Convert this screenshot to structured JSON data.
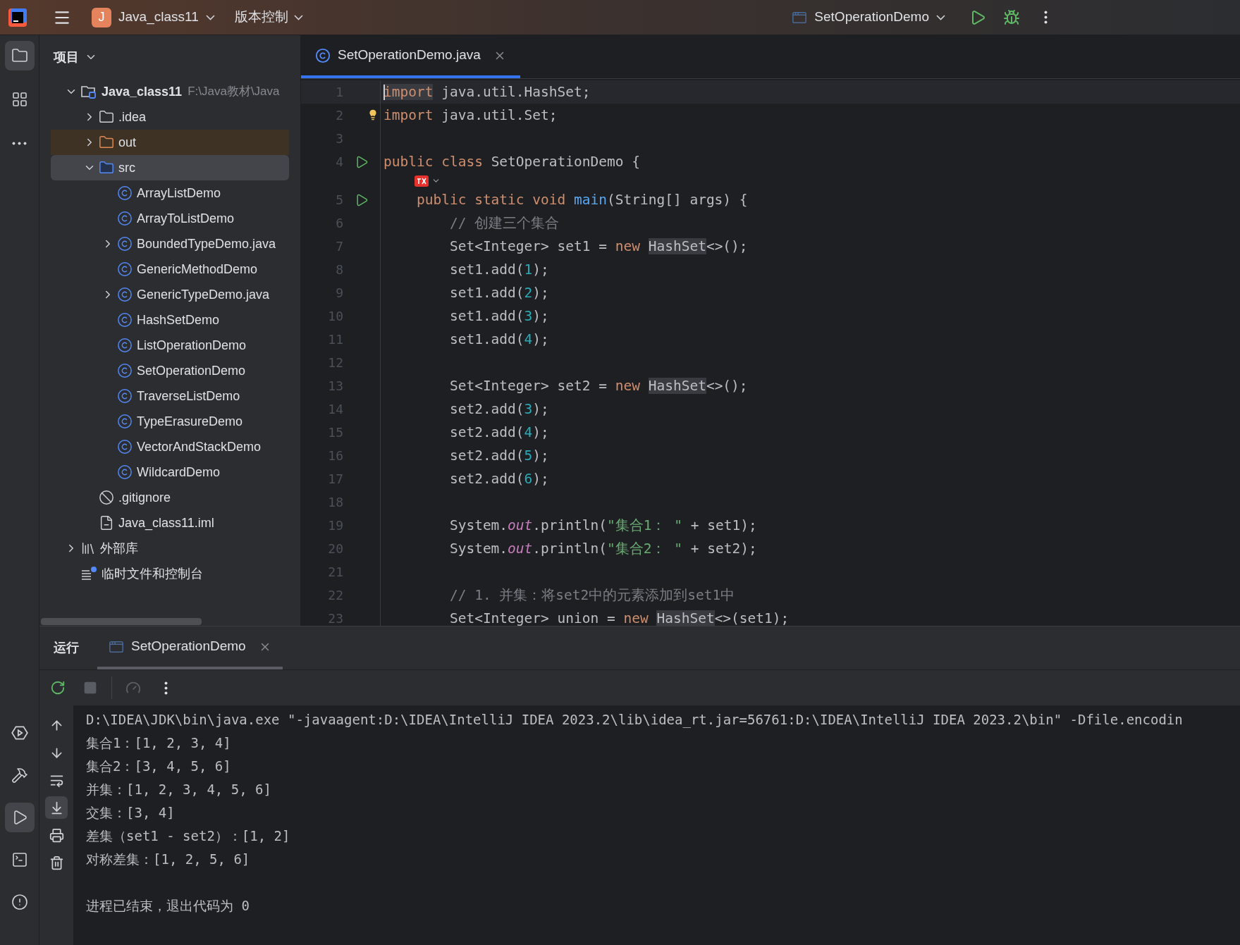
{
  "title_bar": {
    "project": {
      "initial": "J",
      "name": "Java_class11"
    },
    "vcs_menu": "版本控制",
    "run_config": "SetOperationDemo"
  },
  "left_toolbar": {
    "top": [
      {
        "kind": "project",
        "selected": true
      },
      {
        "kind": "structure",
        "selected": false
      },
      {
        "kind": "more",
        "selected": false
      }
    ],
    "bottom": [
      {
        "kind": "services",
        "selected": false
      },
      {
        "kind": "build",
        "selected": false
      },
      {
        "kind": "run",
        "selected": true
      },
      {
        "kind": "terminal",
        "selected": false
      },
      {
        "kind": "problems",
        "selected": false
      }
    ]
  },
  "project_panel": {
    "title": "项目",
    "tree": [
      {
        "kind": "module",
        "name": "Java_class11",
        "path": "F:\\Java教材\\Java",
        "expanded": true,
        "selected": false,
        "children": [
          {
            "kind": "folder",
            "name": ".idea",
            "expanded": false,
            "selected": false
          },
          {
            "kind": "excluded_folder",
            "name": "out",
            "expanded": false,
            "selected": false
          },
          {
            "kind": "source_folder",
            "name": "src",
            "expanded": true,
            "selected": true,
            "children": [
              {
                "kind": "class",
                "name": "ArrayListDemo",
                "selected": false
              },
              {
                "kind": "class",
                "name": "ArrayToListDemo",
                "selected": false
              },
              {
                "kind": "class",
                "name": "BoundedTypeDemo.java",
                "expanded": false,
                "selected": false
              },
              {
                "kind": "class",
                "name": "GenericMethodDemo",
                "selected": false
              },
              {
                "kind": "class",
                "name": "GenericTypeDemo.java",
                "expanded": false,
                "selected": false
              },
              {
                "kind": "class",
                "name": "HashSetDemo",
                "selected": false
              },
              {
                "kind": "class",
                "name": "ListOperationDemo",
                "selected": false
              },
              {
                "kind": "class",
                "name": "SetOperationDemo",
                "selected": false
              },
              {
                "kind": "class",
                "name": "TraverseListDemo",
                "selected": false
              },
              {
                "kind": "class",
                "name": "TypeErasureDemo",
                "selected": false
              },
              {
                "kind": "class",
                "name": "VectorAndStackDemo",
                "selected": false
              },
              {
                "kind": "class",
                "name": "WildcardDemo",
                "selected": false
              }
            ]
          },
          {
            "kind": "ignore_file",
            "name": ".gitignore",
            "selected": false
          },
          {
            "kind": "module_file",
            "name": "Java_class11.iml",
            "selected": false
          }
        ]
      },
      {
        "kind": "library",
        "name": "外部库",
        "expanded": false,
        "selected": false
      },
      {
        "kind": "scratches",
        "name": "临时文件和控制台",
        "selected": false
      }
    ]
  },
  "editor": {
    "tabs": [
      {
        "label": "SetOperationDemo.java",
        "selected": true
      }
    ],
    "lines": [
      {
        "kind": "code",
        "number": "1",
        "current": true,
        "tokens": [
          {
            "kind": "keyword_marked",
            "text": "import"
          },
          {
            "kind": "plain",
            "text": " java.util.HashSet;"
          }
        ]
      },
      {
        "kind": "code",
        "number": "2",
        "hint": true,
        "tokens": [
          {
            "kind": "keyword",
            "text": "import"
          },
          {
            "kind": "plain",
            "text": " java.util.Set;"
          }
        ]
      },
      {
        "kind": "code",
        "number": "3"
      },
      {
        "kind": "code",
        "number": "4",
        "runnable": true,
        "tokens": [
          {
            "kind": "keyword",
            "text": "public class "
          },
          {
            "kind": "plain",
            "text": "SetOperationDemo {"
          }
        ]
      },
      {
        "kind": "inlay"
      },
      {
        "kind": "code",
        "number": "5",
        "runnable": true,
        "tokens": [
          {
            "kind": "keyword",
            "text": "    public static void "
          },
          {
            "kind": "method",
            "text": "main"
          },
          {
            "kind": "plain",
            "text": "(String[] args) {"
          }
        ]
      },
      {
        "kind": "code",
        "number": "6",
        "tokens": [
          {
            "kind": "comment",
            "text": "        // 创建三个集合"
          }
        ]
      },
      {
        "kind": "code",
        "number": "7",
        "tokens": [
          {
            "kind": "plain",
            "text": "        Set<Integer> set1 = "
          },
          {
            "kind": "keyword",
            "text": "new "
          },
          {
            "kind": "type_marked",
            "text": "HashSet"
          },
          {
            "kind": "plain",
            "text": "<>();"
          }
        ]
      },
      {
        "kind": "code",
        "number": "8",
        "tokens": [
          {
            "kind": "plain",
            "text": "        set1.add("
          },
          {
            "kind": "number",
            "text": "1"
          },
          {
            "kind": "plain",
            "text": ");"
          }
        ]
      },
      {
        "kind": "code",
        "number": "9",
        "tokens": [
          {
            "kind": "plain",
            "text": "        set1.add("
          },
          {
            "kind": "number",
            "text": "2"
          },
          {
            "kind": "plain",
            "text": ");"
          }
        ]
      },
      {
        "kind": "code",
        "number": "10",
        "tokens": [
          {
            "kind": "plain",
            "text": "        set1.add("
          },
          {
            "kind": "number",
            "text": "3"
          },
          {
            "kind": "plain",
            "text": ");"
          }
        ]
      },
      {
        "kind": "code",
        "number": "11",
        "tokens": [
          {
            "kind": "plain",
            "text": "        set1.add("
          },
          {
            "kind": "number",
            "text": "4"
          },
          {
            "kind": "plain",
            "text": ");"
          }
        ]
      },
      {
        "kind": "code",
        "number": "12"
      },
      {
        "kind": "code",
        "number": "13",
        "tokens": [
          {
            "kind": "plain",
            "text": "        Set<Integer> set2 = "
          },
          {
            "kind": "keyword",
            "text": "new "
          },
          {
            "kind": "type_marked",
            "text": "HashSet"
          },
          {
            "kind": "plain",
            "text": "<>();"
          }
        ]
      },
      {
        "kind": "code",
        "number": "14",
        "tokens": [
          {
            "kind": "plain",
            "text": "        set2.add("
          },
          {
            "kind": "number",
            "text": "3"
          },
          {
            "kind": "plain",
            "text": ");"
          }
        ]
      },
      {
        "kind": "code",
        "number": "15",
        "tokens": [
          {
            "kind": "plain",
            "text": "        set2.add("
          },
          {
            "kind": "number",
            "text": "4"
          },
          {
            "kind": "plain",
            "text": ");"
          }
        ]
      },
      {
        "kind": "code",
        "number": "16",
        "tokens": [
          {
            "kind": "plain",
            "text": "        set2.add("
          },
          {
            "kind": "number",
            "text": "5"
          },
          {
            "kind": "plain",
            "text": ");"
          }
        ]
      },
      {
        "kind": "code",
        "number": "17",
        "tokens": [
          {
            "kind": "plain",
            "text": "        set2.add("
          },
          {
            "kind": "number",
            "text": "6"
          },
          {
            "kind": "plain",
            "text": ");"
          }
        ]
      },
      {
        "kind": "code",
        "number": "18"
      },
      {
        "kind": "code",
        "number": "19",
        "tokens": [
          {
            "kind": "plain",
            "text": "        System."
          },
          {
            "kind": "static_field",
            "text": "out"
          },
          {
            "kind": "plain",
            "text": ".println("
          },
          {
            "kind": "string",
            "text": "\"集合1： \""
          },
          {
            "kind": "plain",
            "text": " + set1);"
          }
        ]
      },
      {
        "kind": "code",
        "number": "20",
        "tokens": [
          {
            "kind": "plain",
            "text": "        System."
          },
          {
            "kind": "static_field",
            "text": "out"
          },
          {
            "kind": "plain",
            "text": ".println("
          },
          {
            "kind": "string",
            "text": "\"集合2： \""
          },
          {
            "kind": "plain",
            "text": " + set2);"
          }
        ]
      },
      {
        "kind": "code",
        "number": "21"
      },
      {
        "kind": "code",
        "number": "22",
        "tokens": [
          {
            "kind": "comment",
            "text": "        // 1. 并集：将set2中的元素添加到set1中"
          }
        ]
      },
      {
        "kind": "code",
        "number": "23",
        "tokens": [
          {
            "kind": "plain",
            "text": "        Set<Integer> union = "
          },
          {
            "kind": "keyword",
            "text": "new "
          },
          {
            "kind": "type_marked",
            "text": "HashSet"
          },
          {
            "kind": "plain",
            "text": "<>(set1);"
          }
        ]
      }
    ]
  },
  "run_panel": {
    "title": "运行",
    "tabs": [
      {
        "label": "SetOperationDemo",
        "selected": true
      }
    ],
    "side_tools": [
      {
        "kind": "up",
        "selected": false
      },
      {
        "kind": "down",
        "selected": false
      },
      {
        "kind": "wrap",
        "selected": false
      },
      {
        "kind": "scroll_end",
        "selected": true
      },
      {
        "kind": "print",
        "selected": false
      },
      {
        "kind": "clear",
        "selected": false
      }
    ],
    "console": [
      {
        "kind": "output",
        "text": "D:\\IDEA\\JDK\\bin\\java.exe \"-javaagent:D:\\IDEA\\IntelliJ IDEA 2023.2\\lib\\idea_rt.jar=56761:D:\\IDEA\\IntelliJ IDEA 2023.2\\bin\" -Dfile.encodin"
      },
      {
        "kind": "output",
        "text": "集合1：[1, 2, 3, 4]"
      },
      {
        "kind": "output",
        "text": "集合2：[3, 4, 5, 6]"
      },
      {
        "kind": "output",
        "text": "并集：[1, 2, 3, 4, 5, 6]"
      },
      {
        "kind": "output",
        "text": "交集：[3, 4]"
      },
      {
        "kind": "output",
        "text": "差集（set1 - set2）：[1, 2]"
      },
      {
        "kind": "output",
        "text": "对称差集：[1, 2, 5, 6]"
      },
      {
        "kind": "exit",
        "text": "进程已结束，退出代码为 0"
      }
    ]
  }
}
